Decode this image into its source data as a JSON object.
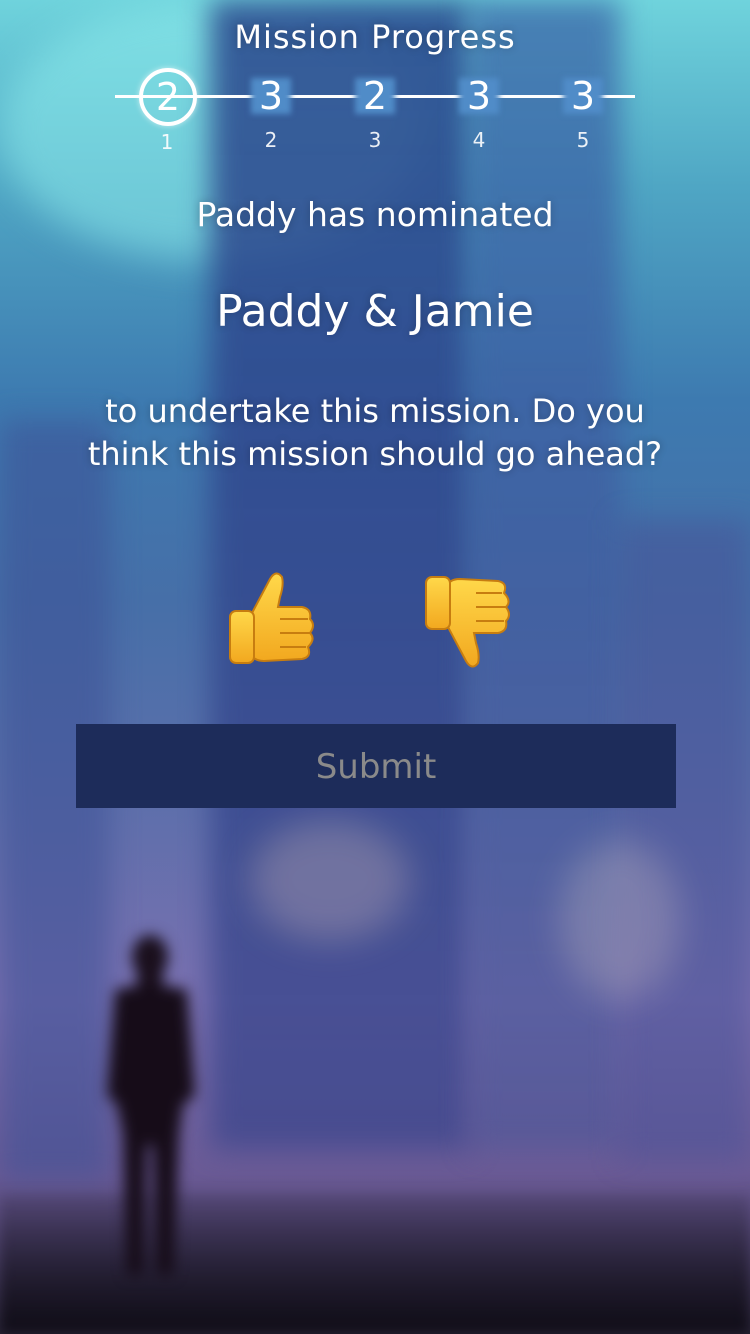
{
  "header": {
    "title": "Mission Progress"
  },
  "progress": {
    "steps": [
      {
        "value": "2",
        "index": "1",
        "active": true
      },
      {
        "value": "3",
        "index": "2",
        "active": false
      },
      {
        "value": "2",
        "index": "3",
        "active": false
      },
      {
        "value": "3",
        "index": "4",
        "active": false
      },
      {
        "value": "3",
        "index": "5",
        "active": false
      }
    ]
  },
  "nomination": {
    "intro": "Paddy has nominated",
    "team": "Paddy & Jamie",
    "question": "to undertake this mission. Do you think this mission should go ahead?"
  },
  "votes": {
    "approve_icon": "thumbs-up-icon",
    "reject_icon": "thumbs-down-icon"
  },
  "submit": {
    "label": "Submit",
    "color": "#1d2c5a",
    "text_color": "#8a8a8a"
  }
}
